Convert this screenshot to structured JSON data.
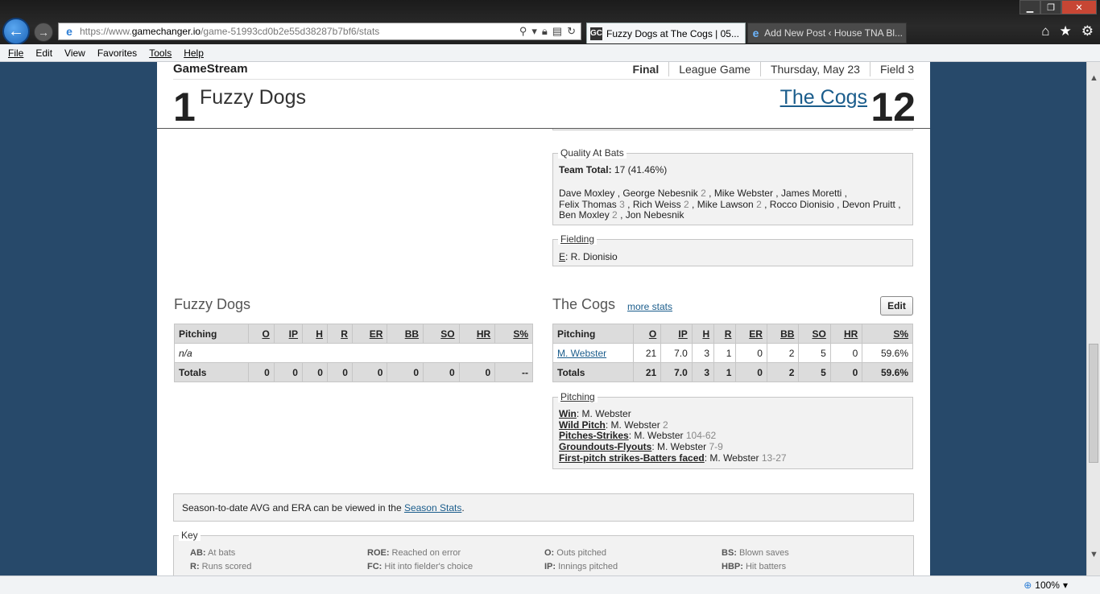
{
  "browser": {
    "url_prefix": "https://www.",
    "url_domain": "gamechanger.io",
    "url_path": "/game-51993cd0b2e55d38287b7bf6/stats",
    "tabs": [
      {
        "label": "Fuzzy Dogs at The Cogs | 05...",
        "icon": "GC"
      },
      {
        "label": "Add New Post ‹ House TNA Bl...",
        "icon": "e"
      }
    ],
    "menu": [
      "File",
      "Edit",
      "View",
      "Favorites",
      "Tools",
      "Help"
    ],
    "zoom": "100%"
  },
  "header": {
    "brand": "GameStream",
    "status": "Final",
    "league": "League Game",
    "date": "Thursday, May 23",
    "field": "Field 3",
    "home_score": "1",
    "home_team": "Fuzzy Dogs",
    "away_team": "The Cogs",
    "away_score": "12"
  },
  "qab": {
    "legend": "Quality At Bats",
    "total_label": "Team Total:",
    "total_value": " 17 (41.46%)",
    "names": [
      {
        "name": "Dave Moxley",
        "count": ""
      },
      {
        "name": "George Nebesnik",
        "count": "2"
      },
      {
        "name": "Mike Webster",
        "count": ""
      },
      {
        "name": "James Moretti",
        "count": ""
      },
      {
        "name": "Felix Thomas",
        "count": "3"
      },
      {
        "name": "Rich Weiss",
        "count": "2"
      },
      {
        "name": "Mike Lawson",
        "count": "2"
      },
      {
        "name": "Rocco Dionisio",
        "count": ""
      },
      {
        "name": "Devon Pruitt",
        "count": ""
      },
      {
        "name": "Ben Moxley",
        "count": "2"
      },
      {
        "name": "Jon Nebesnik",
        "count": ""
      }
    ]
  },
  "fielding": {
    "legend": "Fielding",
    "key": "E",
    "value": ": R. Dionisio"
  },
  "left_team": {
    "name": "Fuzzy Dogs",
    "headers": [
      "Pitching",
      "O",
      "IP",
      "H",
      "R",
      "ER",
      "BB",
      "SO",
      "HR",
      "S%"
    ],
    "rows": [
      [
        "n/a"
      ]
    ],
    "totals": [
      "Totals",
      "0",
      "0",
      "0",
      "0",
      "0",
      "0",
      "0",
      "0",
      "--"
    ]
  },
  "right_team": {
    "name": "The Cogs",
    "more_stats": "more stats",
    "edit": "Edit",
    "headers": [
      "Pitching",
      "O",
      "IP",
      "H",
      "R",
      "ER",
      "BB",
      "SO",
      "HR",
      "S%"
    ],
    "rows": [
      [
        "M. Webster",
        "21",
        "7.0",
        "3",
        "1",
        "0",
        "2",
        "5",
        "0",
        "59.6%"
      ]
    ],
    "totals": [
      "Totals",
      "21",
      "7.0",
      "3",
      "1",
      "0",
      "2",
      "5",
      "0",
      "59.6%"
    ]
  },
  "pitching": {
    "legend": "Pitching",
    "lines": [
      {
        "label": "Win",
        "value": ": M. Webster",
        "extra": ""
      },
      {
        "label": "Wild Pitch",
        "value": ": M. Webster",
        "extra": " 2"
      },
      {
        "label": "Pitches-Strikes",
        "value": ": M. Webster",
        "extra": " 104-62"
      },
      {
        "label": "Groundouts-Flyouts",
        "value": ": M. Webster",
        "extra": " 7-9"
      },
      {
        "label": "First-pitch strikes-Batters faced",
        "value": ": M. Webster",
        "extra": " 13-27"
      }
    ]
  },
  "season": {
    "text": "Season-to-date AVG and ERA can be viewed in the ",
    "link": "Season Stats",
    "end": "."
  },
  "key": {
    "legend": "Key",
    "items": [
      {
        "abbr": "AB:",
        "desc": " At bats"
      },
      {
        "abbr": "ROE:",
        "desc": " Reached on error"
      },
      {
        "abbr": "O:",
        "desc": " Outs pitched"
      },
      {
        "abbr": "BS:",
        "desc": " Blown saves"
      },
      {
        "abbr": "R:",
        "desc": " Runs scored"
      },
      {
        "abbr": "FC:",
        "desc": " Hit into fielder's choice"
      },
      {
        "abbr": "IP:",
        "desc": " Innings pitched"
      },
      {
        "abbr": "HBP:",
        "desc": " Hit batters"
      }
    ]
  }
}
